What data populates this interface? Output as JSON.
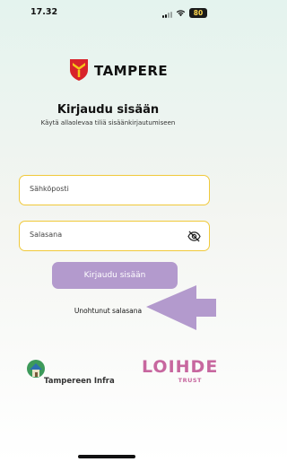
{
  "status_bar": {
    "time": "17.32",
    "battery": "80"
  },
  "brand": {
    "logo_text": "TAMPERE"
  },
  "login": {
    "title": "Kirjaudu sisään",
    "subtitle": "Käytä allaolevaa tiliä sisäänkirjautumiseen",
    "email_placeholder": "Sähköposti",
    "password_placeholder": "Salasana",
    "login_button": "Kirjaudu sisään",
    "forgot_link": "Unohtunut salasana"
  },
  "partners": {
    "infra_name": "Tampereen Infra",
    "loihde_name": "LOIHDE",
    "loihde_tagline": "TRUST"
  },
  "colors": {
    "accent_purple": "#b39acd",
    "field_border": "#f0c93a",
    "logo_red": "#d8232a",
    "logo_yellow": "#f5c518",
    "loihde_pink": "#c7679f"
  }
}
